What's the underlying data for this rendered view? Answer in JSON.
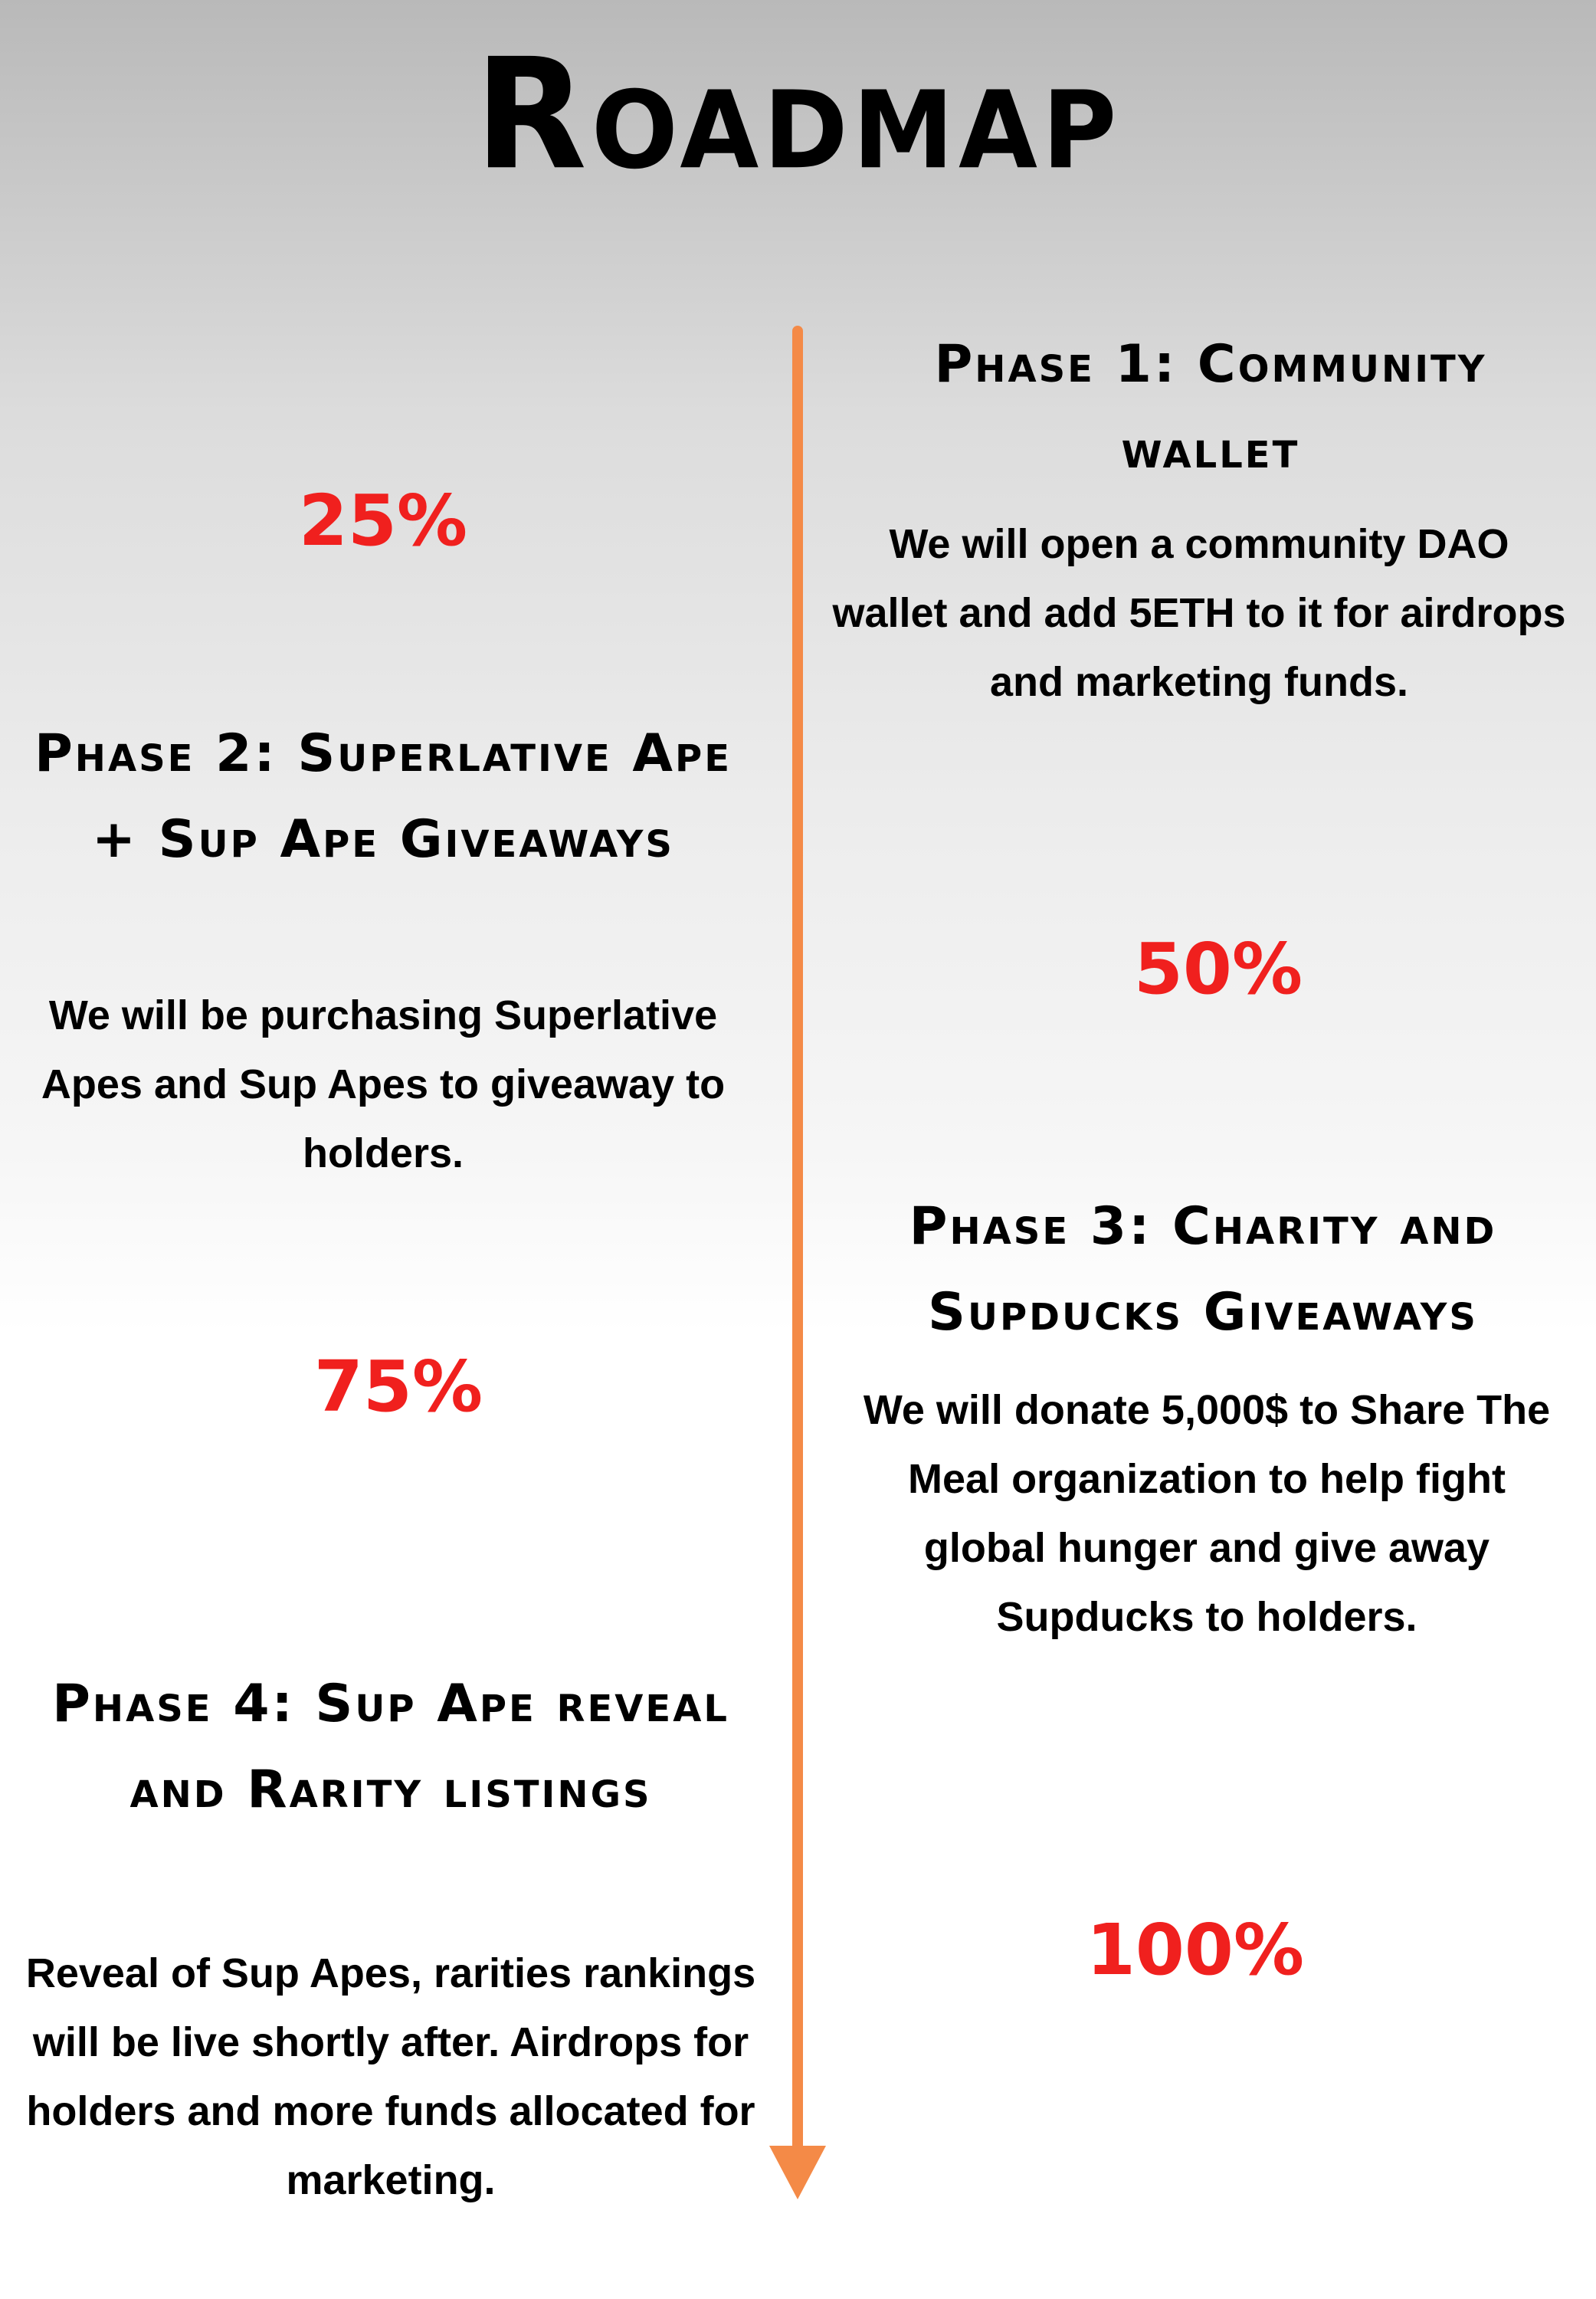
{
  "title": "Roadmap",
  "accent_color": "#f48a47",
  "percent_color": "#f0201e",
  "timeline": {
    "line_icon": "vertical-line",
    "arrow_icon": "arrow-down-icon"
  },
  "phases": [
    {
      "heading": "Phase 1: Community wallet",
      "description": "We will open a community DAO wallet and add 5ETH to it for airdrops and marketing funds.",
      "percent": "25%"
    },
    {
      "heading": "Phase 2: Superlative Ape + Sup Ape Giveaways",
      "description": "We will be purchasing Superlative Apes and Sup Apes to giveaway to holders.",
      "percent": "50%"
    },
    {
      "heading": "Phase 3: Charity and Supducks Giveaways",
      "description": "We will donate 5,000$ to Share The Meal organization to help fight global hunger and give away Supducks to holders.",
      "percent": "75%"
    },
    {
      "heading": "Phase 4: Sup Ape reveal and Rarity listings",
      "description": "Reveal of Sup Apes, rarities rankings will be live shortly after. Airdrops for holders and more funds allocated for marketing.",
      "percent": "100%"
    }
  ]
}
